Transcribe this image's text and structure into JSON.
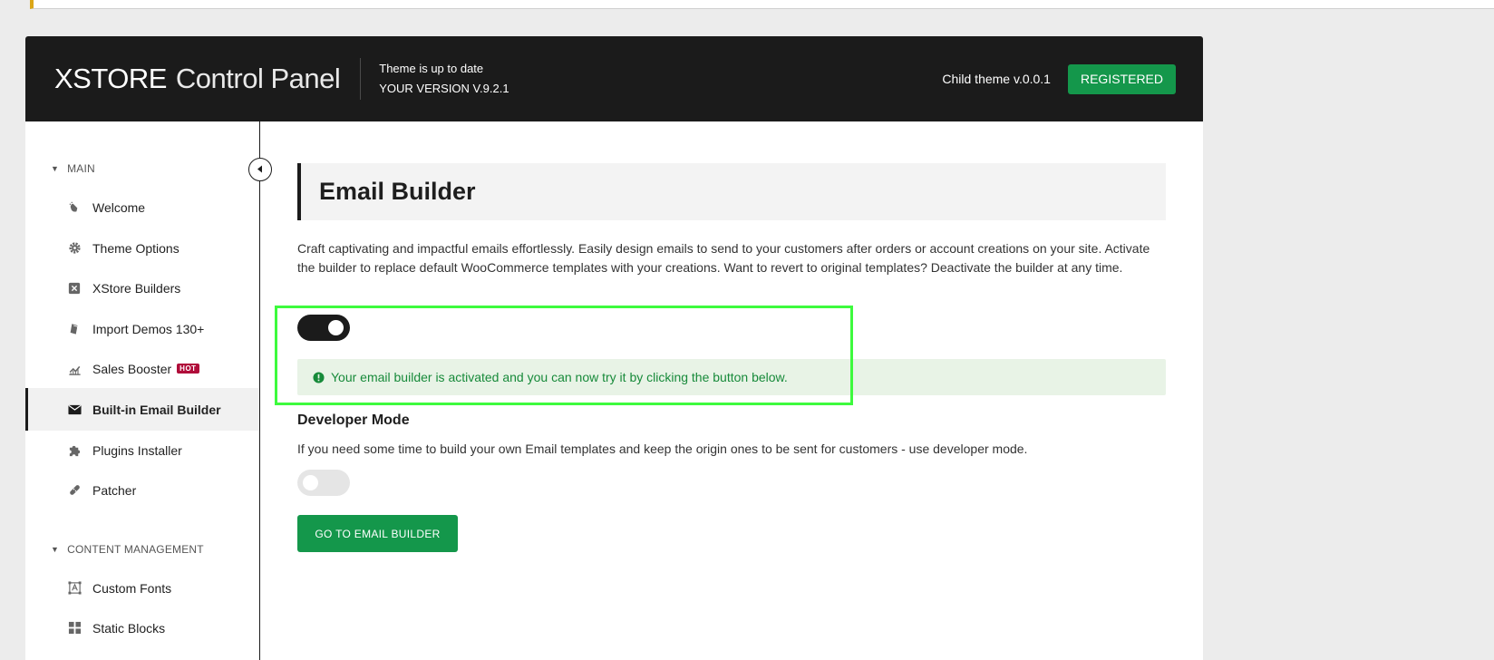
{
  "header": {
    "logo_brand": "XSTORE",
    "logo_sub": "Control Panel",
    "status_line": "Theme is up to date",
    "version_line": "YOUR VERSION V.9.2.1",
    "child_theme": "Child theme v.0.0.1",
    "registered_label": "REGISTERED"
  },
  "sidebar": {
    "main_section": "MAIN",
    "main_items": [
      {
        "label": "Welcome",
        "icon": "hand-wave-icon"
      },
      {
        "label": "Theme Options",
        "icon": "gear-icon"
      },
      {
        "label": "XStore Builders",
        "icon": "xstore-builder-icon"
      },
      {
        "label": "Import Demos 130+",
        "icon": "import-icon"
      },
      {
        "label": "Sales Booster",
        "icon": "chart-icon",
        "badge": "HOT"
      },
      {
        "label": "Built-in Email Builder",
        "icon": "envelope-icon",
        "active": true
      },
      {
        "label": "Plugins Installer",
        "icon": "puzzle-icon"
      },
      {
        "label": "Patcher",
        "icon": "bandage-icon"
      }
    ],
    "content_section": "CONTENT MANAGEMENT",
    "content_items": [
      {
        "label": "Custom Fonts",
        "icon": "font-icon"
      },
      {
        "label": "Static Blocks",
        "icon": "grid-icon"
      }
    ]
  },
  "main": {
    "title": "Email Builder",
    "description": "Craft captivating and impactful emails effortlessly. Easily design emails to send to your customers after orders or account creations on your site. Activate the builder to replace default WooCommerce templates with your creations. Want to revert to original templates? Deactivate the builder at any time.",
    "builder_toggle_on": true,
    "success_message": "Your email builder is activated and you can now try it by clicking the button below.",
    "dev_mode_title": "Developer Mode",
    "dev_mode_desc": "If you need some time to build your own Email templates and keep the origin ones to be sent for customers - use developer mode.",
    "dev_mode_toggle_on": false,
    "go_button": "GO TO EMAIL BUILDER"
  },
  "colors": {
    "header_bg": "#1b1b1b",
    "accent_green": "#14974b",
    "hot_badge": "#b00d3a",
    "success_bg": "#e8f3e6",
    "highlight": "#3dfa3d"
  }
}
